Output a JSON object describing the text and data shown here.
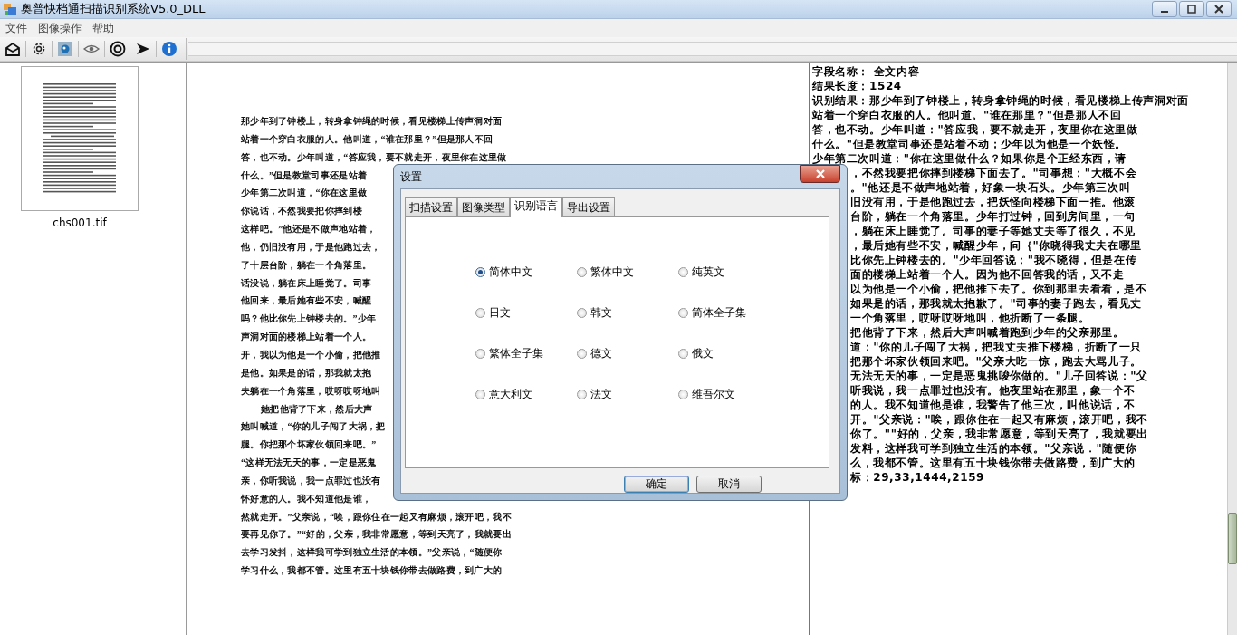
{
  "window": {
    "title": "奥普快档通扫描识别系统V5.0_DLL"
  },
  "menu": [
    "文件",
    "图像操作",
    "帮助"
  ],
  "thumbnails": [
    {
      "filename": "chs001.tif"
    }
  ],
  "document": {
    "lines": [
      {
        "text": "那少年到了钟楼上，转身拿钟绳的时候，看见楼梯上传声洞对面",
        "kind": "line"
      },
      {
        "text": "站着一个穿白衣服的人。他叫道，“谁在那里？”但是那人不回",
        "kind": "line"
      },
      {
        "text": "答，也不动。少年叫道，“答应我，要不就走开，夜里你在这里做",
        "kind": "line"
      },
      {
        "text": "什么。”但是教堂司事还是站着",
        "kind": "line"
      },
      {
        "text": "少年第二次叫道，“你在这里做",
        "kind": "line"
      },
      {
        "text": "你说话，不然我要把你摔到楼",
        "kind": "line"
      },
      {
        "text": "这样吧。”他还是不做声地站着，",
        "kind": "line"
      },
      {
        "text": "他，仍旧没有用，于是他跑过去，",
        "kind": "line"
      },
      {
        "text": "了十层台阶，躺在一个角落里。",
        "kind": "line"
      },
      {
        "text": "话没说，躺在床上睡觉了。司事",
        "kind": "line"
      },
      {
        "text": "他回来，最后她有些不安，喊醒",
        "kind": "line"
      },
      {
        "text": "吗？他比你先上钟楼去的。”少年",
        "kind": "line"
      },
      {
        "text": "声洞对面的楼梯上站着一个人。",
        "kind": "line"
      },
      {
        "text": "开，我以为他是一个小偷，把他推",
        "kind": "line"
      },
      {
        "text": "是他。如果是的话，那我就太抱",
        "kind": "line"
      },
      {
        "text": "夫躺在一个角落里，哎呀哎呀地叫",
        "kind": "line"
      },
      {
        "text": "她把他背了下来，然后大声",
        "kind": "indent"
      },
      {
        "text": "她叫喊道，“你的儿子闯了大祸，把",
        "kind": "line"
      },
      {
        "text": "腿。你把那个坏家伙领回来吧。”",
        "kind": "line"
      },
      {
        "text": "“这样无法无天的事，一定是恶鬼",
        "kind": "line"
      },
      {
        "text": "亲，你听我说，我一点罪过也没有",
        "kind": "line"
      },
      {
        "text": "怀好意的人。我不知道他是谁，",
        "kind": "line"
      },
      {
        "text": "然就走开。”父亲说，“唉，跟你住在一起又有麻烦，滚开吧，我不",
        "kind": "line"
      },
      {
        "text": "要再见你了。”“好的，父亲，我非常愿意，等到天亮了，我就要出",
        "kind": "line"
      },
      {
        "text": "去学习发抖，这样我可学到独立生活的本领。”父亲说，“随便你",
        "kind": "line"
      },
      {
        "text": "学习什么，我都不管。这里有五十块钱你带去做路费，到广大的",
        "kind": "line"
      }
    ]
  },
  "result_panel": {
    "lines": [
      {
        "text": "字段名称： 全文内容",
        "kind": "full"
      },
      {
        "text": "结果长度：1524",
        "kind": "full"
      },
      {
        "text": "识别结果：那少年到了钟楼上，转身拿钟绳的时候，看见楼梯上传声洞对面",
        "kind": "full"
      },
      {
        "text": "站着一个穿白衣服的人。他叫道。\"谁在那里？\"但是那人不回",
        "kind": "full"
      },
      {
        "text": "答，也不动。少年叫道：\"答应我，要不就走开，夜里你在这里做",
        "kind": "full"
      },
      {
        "text": "什么。\"但是教堂司事还是站着不动；少年以为他是一个妖怪。",
        "kind": "full"
      },
      {
        "text": "少年第二次叫道：\"你在这里做什么？如果你是个正经东西，请",
        "kind": "full"
      },
      {
        "text": "，不然我要把你摔到楼梯下面去了。\"司事想：\"大概不会",
        "kind": "covered"
      },
      {
        "text": "。\"他还是不做声地站着，好象一块石头。少年第三次叫",
        "kind": "covered"
      },
      {
        "text": "旧没有用，于是他跑过去，把妖怪向楼梯下面一推。他滚",
        "kind": "covered"
      },
      {
        "text": "台阶，躺在一个角落里。少年打过钟，回到房间里，一句",
        "kind": "covered"
      },
      {
        "text": "，躺在床上睡觉了。司事的妻子等她丈夫等了很久，不见",
        "kind": "covered"
      },
      {
        "text": "，最后她有些不安，喊醒少年，问｛\"你晓得我丈夫在哪里",
        "kind": "covered"
      },
      {
        "text": "比你先上钟楼去的。\"少年回答说：\"我不晓得，但是在传",
        "kind": "covered"
      },
      {
        "text": "面的楼梯上站着一个人。因为他不回答我的话，又不走",
        "kind": "covered"
      },
      {
        "text": "以为他是一个小偷，把他推下去了。你到那里去看看，是不",
        "kind": "covered"
      },
      {
        "text": "如果是的话，那我就太抱歉了。\"司事的妻子跑去，看见丈",
        "kind": "covered"
      },
      {
        "text": "一个角落里，哎呀哎呀地叫，他折断了一条腿。",
        "kind": "covered"
      },
      {
        "text": "把他背了下来，然后大声叫喊着跑到少年的父亲那里。",
        "kind": "covered"
      },
      {
        "text": "道：\"你的儿子闯了大祸，把我丈夫推下楼梯，折断了一只",
        "kind": "covered"
      },
      {
        "text": "把那个坏家伙领回来吧。\"父亲大吃一惊，跑去大骂儿子。",
        "kind": "covered"
      },
      {
        "text": "无法无天的事，一定是恶鬼挑唆你做的。\"儿子回答说：\"父",
        "kind": "covered"
      },
      {
        "text": "听我说，我一点罪过也没有。他夜里站在那里，象一个不",
        "kind": "covered"
      },
      {
        "text": "的人。我不知道他是谁，我警告了他三次，叫他说话，不",
        "kind": "covered"
      },
      {
        "text": "开。\"父亲说：\"唉，跟你住在一起又有麻烦，滚开吧，我不",
        "kind": "covered"
      },
      {
        "text": "你了。\"\"好的，父亲，我非常愿意，等到天亮了，我就要出",
        "kind": "covered"
      },
      {
        "text": "发料，这样我可学到独立生活的本领。\"父亲说．\"随便你",
        "kind": "covered"
      },
      {
        "text": "么，我都不管。这里有五十块钱你带去做路费，到广大的",
        "kind": "covered"
      },
      {
        "text": "标：29,33,1444,2159",
        "kind": "covered"
      }
    ]
  },
  "dialog": {
    "title": "设置",
    "tabs": [
      {
        "label": "扫描设置",
        "selected": false
      },
      {
        "label": "图像类型",
        "selected": false
      },
      {
        "label": "识别语言",
        "selected": true
      },
      {
        "label": "导出设置",
        "selected": false
      }
    ],
    "options": [
      {
        "label": "简体中文",
        "selected": true
      },
      {
        "label": "繁体中文",
        "selected": false
      },
      {
        "label": "纯英文",
        "selected": false
      },
      {
        "label": "日文",
        "selected": false
      },
      {
        "label": "韩文",
        "selected": false
      },
      {
        "label": "简体全子集",
        "selected": false
      },
      {
        "label": "繁体全子集",
        "selected": false
      },
      {
        "label": "德文",
        "selected": false
      },
      {
        "label": "俄文",
        "selected": false
      },
      {
        "label": "意大利文",
        "selected": false
      },
      {
        "label": "法文",
        "selected": false
      },
      {
        "label": "维吾尔文",
        "selected": false
      }
    ],
    "buttons": [
      {
        "label": "确定",
        "kind": "default"
      },
      {
        "label": "取消",
        "kind": "normal"
      }
    ]
  }
}
